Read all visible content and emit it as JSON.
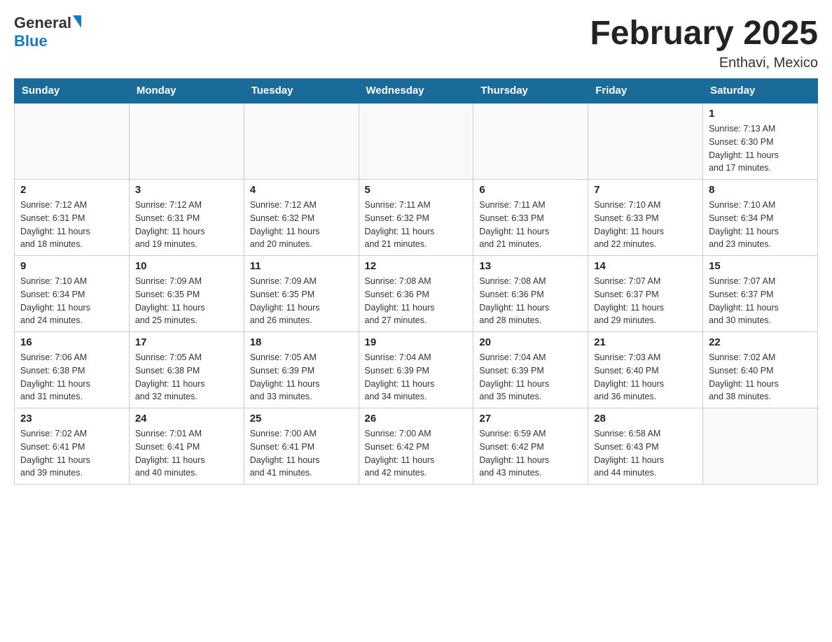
{
  "header": {
    "logo": {
      "general": "General",
      "blue": "Blue"
    },
    "month": "February 2025",
    "location": "Enthavi, Mexico"
  },
  "weekdays": [
    "Sunday",
    "Monday",
    "Tuesday",
    "Wednesday",
    "Thursday",
    "Friday",
    "Saturday"
  ],
  "weeks": [
    [
      {
        "day": "",
        "info": ""
      },
      {
        "day": "",
        "info": ""
      },
      {
        "day": "",
        "info": ""
      },
      {
        "day": "",
        "info": ""
      },
      {
        "day": "",
        "info": ""
      },
      {
        "day": "",
        "info": ""
      },
      {
        "day": "1",
        "info": "Sunrise: 7:13 AM\nSunset: 6:30 PM\nDaylight: 11 hours\nand 17 minutes."
      }
    ],
    [
      {
        "day": "2",
        "info": "Sunrise: 7:12 AM\nSunset: 6:31 PM\nDaylight: 11 hours\nand 18 minutes."
      },
      {
        "day": "3",
        "info": "Sunrise: 7:12 AM\nSunset: 6:31 PM\nDaylight: 11 hours\nand 19 minutes."
      },
      {
        "day": "4",
        "info": "Sunrise: 7:12 AM\nSunset: 6:32 PM\nDaylight: 11 hours\nand 20 minutes."
      },
      {
        "day": "5",
        "info": "Sunrise: 7:11 AM\nSunset: 6:32 PM\nDaylight: 11 hours\nand 21 minutes."
      },
      {
        "day": "6",
        "info": "Sunrise: 7:11 AM\nSunset: 6:33 PM\nDaylight: 11 hours\nand 21 minutes."
      },
      {
        "day": "7",
        "info": "Sunrise: 7:10 AM\nSunset: 6:33 PM\nDaylight: 11 hours\nand 22 minutes."
      },
      {
        "day": "8",
        "info": "Sunrise: 7:10 AM\nSunset: 6:34 PM\nDaylight: 11 hours\nand 23 minutes."
      }
    ],
    [
      {
        "day": "9",
        "info": "Sunrise: 7:10 AM\nSunset: 6:34 PM\nDaylight: 11 hours\nand 24 minutes."
      },
      {
        "day": "10",
        "info": "Sunrise: 7:09 AM\nSunset: 6:35 PM\nDaylight: 11 hours\nand 25 minutes."
      },
      {
        "day": "11",
        "info": "Sunrise: 7:09 AM\nSunset: 6:35 PM\nDaylight: 11 hours\nand 26 minutes."
      },
      {
        "day": "12",
        "info": "Sunrise: 7:08 AM\nSunset: 6:36 PM\nDaylight: 11 hours\nand 27 minutes."
      },
      {
        "day": "13",
        "info": "Sunrise: 7:08 AM\nSunset: 6:36 PM\nDaylight: 11 hours\nand 28 minutes."
      },
      {
        "day": "14",
        "info": "Sunrise: 7:07 AM\nSunset: 6:37 PM\nDaylight: 11 hours\nand 29 minutes."
      },
      {
        "day": "15",
        "info": "Sunrise: 7:07 AM\nSunset: 6:37 PM\nDaylight: 11 hours\nand 30 minutes."
      }
    ],
    [
      {
        "day": "16",
        "info": "Sunrise: 7:06 AM\nSunset: 6:38 PM\nDaylight: 11 hours\nand 31 minutes."
      },
      {
        "day": "17",
        "info": "Sunrise: 7:05 AM\nSunset: 6:38 PM\nDaylight: 11 hours\nand 32 minutes."
      },
      {
        "day": "18",
        "info": "Sunrise: 7:05 AM\nSunset: 6:39 PM\nDaylight: 11 hours\nand 33 minutes."
      },
      {
        "day": "19",
        "info": "Sunrise: 7:04 AM\nSunset: 6:39 PM\nDaylight: 11 hours\nand 34 minutes."
      },
      {
        "day": "20",
        "info": "Sunrise: 7:04 AM\nSunset: 6:39 PM\nDaylight: 11 hours\nand 35 minutes."
      },
      {
        "day": "21",
        "info": "Sunrise: 7:03 AM\nSunset: 6:40 PM\nDaylight: 11 hours\nand 36 minutes."
      },
      {
        "day": "22",
        "info": "Sunrise: 7:02 AM\nSunset: 6:40 PM\nDaylight: 11 hours\nand 38 minutes."
      }
    ],
    [
      {
        "day": "23",
        "info": "Sunrise: 7:02 AM\nSunset: 6:41 PM\nDaylight: 11 hours\nand 39 minutes."
      },
      {
        "day": "24",
        "info": "Sunrise: 7:01 AM\nSunset: 6:41 PM\nDaylight: 11 hours\nand 40 minutes."
      },
      {
        "day": "25",
        "info": "Sunrise: 7:00 AM\nSunset: 6:41 PM\nDaylight: 11 hours\nand 41 minutes."
      },
      {
        "day": "26",
        "info": "Sunrise: 7:00 AM\nSunset: 6:42 PM\nDaylight: 11 hours\nand 42 minutes."
      },
      {
        "day": "27",
        "info": "Sunrise: 6:59 AM\nSunset: 6:42 PM\nDaylight: 11 hours\nand 43 minutes."
      },
      {
        "day": "28",
        "info": "Sunrise: 6:58 AM\nSunset: 6:43 PM\nDaylight: 11 hours\nand 44 minutes."
      },
      {
        "day": "",
        "info": ""
      }
    ]
  ]
}
